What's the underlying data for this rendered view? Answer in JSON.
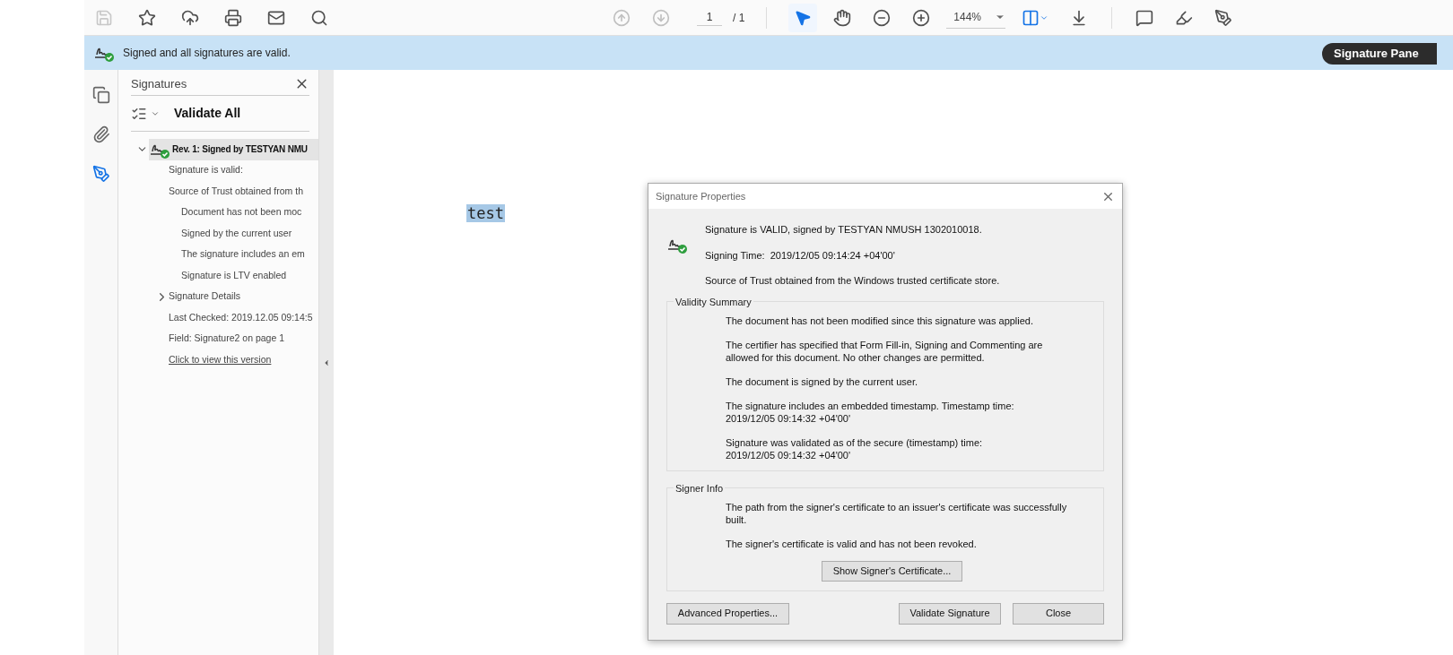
{
  "toolbar": {
    "save_disabled": true,
    "prev_disabled": true,
    "next_disabled": true,
    "page": "1",
    "page_total": "/ 1",
    "zoom": "144%",
    "tools": [
      {
        "kind": "select",
        "selected": true
      },
      {
        "kind": "hand",
        "selected": false
      }
    ]
  },
  "banner": {
    "message": "Signed and all signatures are valid.",
    "button": "Signature Pane"
  },
  "rail": [
    {
      "kind": "pages",
      "selected": false
    },
    {
      "kind": "attachments",
      "selected": false
    },
    {
      "kind": "signatures",
      "selected": true
    }
  ],
  "panel": {
    "title": "Signatures",
    "validate_all": "Validate All",
    "tree": [
      {
        "label": "Rev. 1: Signed by TESTYAN NMU",
        "expanded": true,
        "selected": true,
        "children": [
          {
            "label": "Signature is valid:"
          },
          {
            "label": "Source of Trust obtained from th",
            "children": [
              {
                "label": "Document has not been moc"
              },
              {
                "label": "Signed by the current user"
              },
              {
                "label": "The signature includes an em"
              },
              {
                "label": "Signature is LTV enabled"
              }
            ]
          },
          {
            "label": "Signature Details",
            "expanded": false
          },
          {
            "label": "Last Checked: 2019.12.05 09:14:5"
          },
          {
            "label": "Field: Signature2 on page 1"
          },
          {
            "label": "Click to view this version",
            "kind": "link"
          }
        ]
      }
    ]
  },
  "document": {
    "text": "test"
  },
  "dialog": {
    "title": "Signature Properties",
    "header": [
      "Signature is VALID, signed by TESTYAN NMUSH 1302010018.",
      "Signing Time:  2019/12/05 09:14:24 +04'00'",
      "Source of Trust obtained from the Windows trusted certificate store."
    ],
    "validity_summary": {
      "legend": "Validity Summary",
      "lines": [
        "The document has not been modified since this signature was applied.",
        "The certifier has specified that Form Fill-in, Signing and Commenting are\nallowed for this document. No other changes are permitted.",
        "The document is signed by the current user.",
        "The signature includes an embedded timestamp. Timestamp time:\n2019/12/05 09:14:32 +04'00'",
        "Signature was validated as of the secure (timestamp) time:\n2019/12/05 09:14:32 +04'00'"
      ]
    },
    "signer_info": {
      "legend": "Signer Info",
      "lines": [
        "The path from the signer's certificate to an issuer's certificate was successfully\nbuilt.",
        "The signer's certificate is valid and has not been revoked."
      ],
      "button": "Show Signer's Certificate..."
    },
    "buttons": [
      "Advanced Properties...",
      "Validate Signature",
      "Close"
    ]
  }
}
